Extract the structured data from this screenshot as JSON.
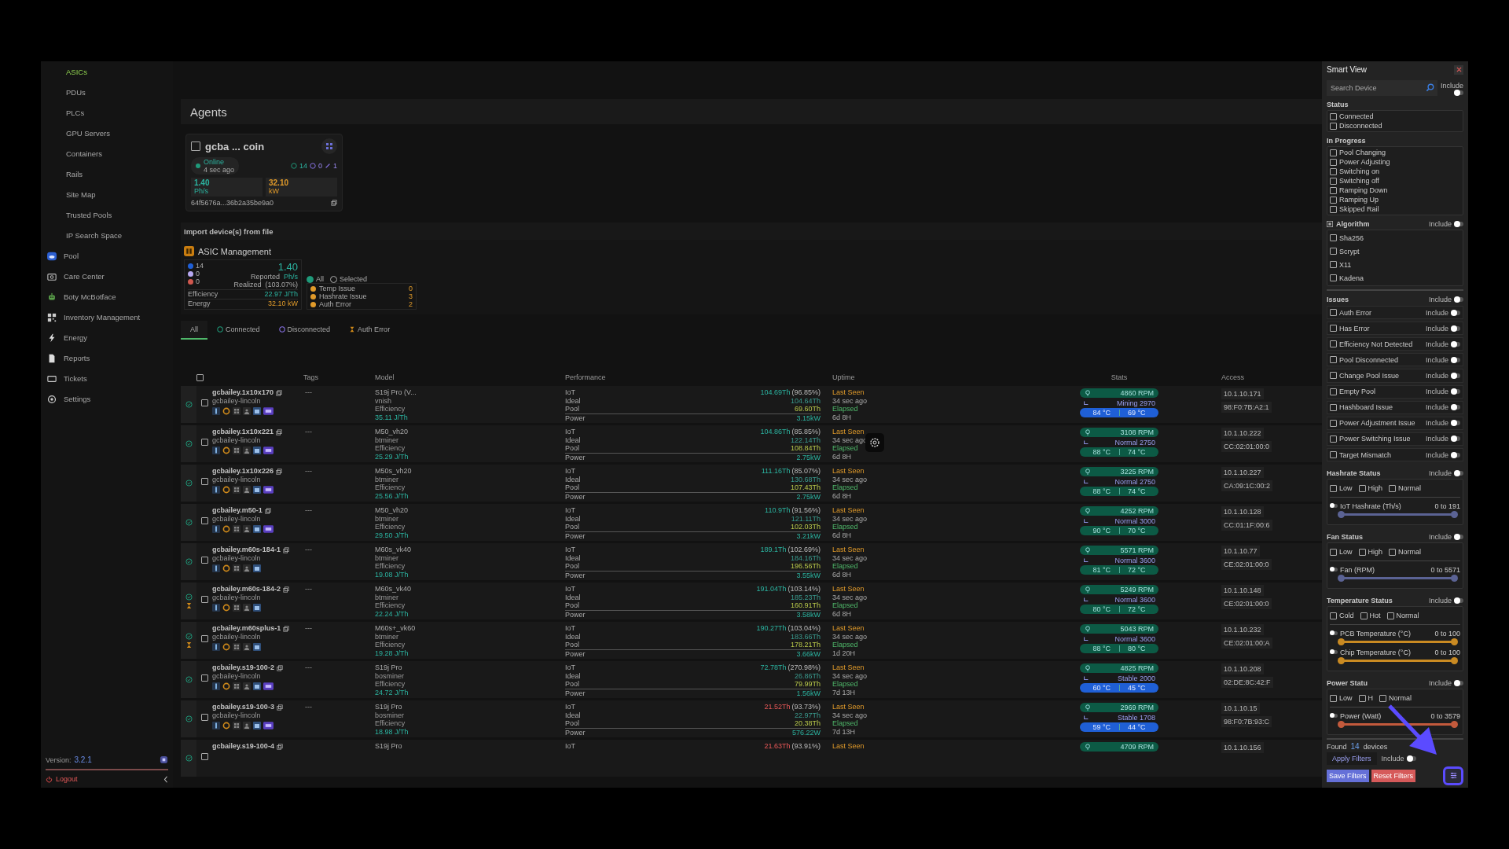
{
  "sidebar": {
    "sub_items": [
      {
        "label": "ASICs",
        "selected": true
      },
      {
        "label": "PDUs",
        "selected": false
      },
      {
        "label": "PLCs",
        "selected": false
      },
      {
        "label": "GPU Servers",
        "selected": false
      },
      {
        "label": "Containers",
        "selected": false
      },
      {
        "label": "Rails",
        "selected": false
      },
      {
        "label": "Site Map",
        "selected": false
      },
      {
        "label": "Trusted Pools",
        "selected": false
      },
      {
        "label": "IP Search Space",
        "selected": false
      }
    ],
    "items": [
      {
        "label": "Pool"
      },
      {
        "label": "Care Center"
      },
      {
        "label": "Boty McBotface"
      },
      {
        "label": "Inventory Management"
      },
      {
        "label": "Energy"
      },
      {
        "label": "Reports"
      },
      {
        "label": "Tickets"
      },
      {
        "label": "Settings"
      }
    ],
    "version_label": "Version:",
    "version": "3.2.1",
    "logout": "Logout"
  },
  "page_title": "Agents",
  "agent": {
    "name": "gcba ... coin",
    "checked": false,
    "status": "Online",
    "seen": "4 sec ago",
    "counts": [
      "14",
      "0",
      "1"
    ],
    "hashrate": "1.40",
    "hashrate_unit": "Ph/s",
    "power": "32.10",
    "power_unit": "kW",
    "id": "64f5676a...36b2a35be9a0"
  },
  "import_label": "Import device(s) from file",
  "management": {
    "title": "ASIC Management",
    "legend": [
      {
        "count": "14",
        "color": "#1f5fd6"
      },
      {
        "count": "0",
        "color": "#b7a8f0"
      },
      {
        "count": "0",
        "color": "#d0584f"
      }
    ],
    "reported": "1.40",
    "reported_label": "Reported",
    "reported_unit": "Ph/s",
    "realized_label": "Realized",
    "realized": "(103.07%)",
    "metrics": [
      {
        "label": "Efficiency",
        "value": "22.97 J/Th"
      },
      {
        "label": "Energy",
        "value": "32.10 kW"
      }
    ],
    "scope": [
      {
        "label": "All",
        "selected": true
      },
      {
        "label": "Selected",
        "selected": false
      }
    ],
    "issues": [
      {
        "label": "Temp Issue",
        "count": "0"
      },
      {
        "label": "Hashrate Issue",
        "count": "3"
      },
      {
        "label": "Auth Error",
        "count": "2"
      }
    ]
  },
  "tabs": [
    {
      "label": "All",
      "selected": true
    },
    {
      "label": "Connected",
      "selected": false
    },
    {
      "label": "Disconnected",
      "selected": false
    },
    {
      "label": "Auth Error",
      "selected": false
    }
  ],
  "table": {
    "select_all_checked": false,
    "columns": [
      "Tags",
      "Model",
      "Performance",
      "Uptime",
      "Stats",
      "Access"
    ],
    "rows": [
      {
        "name": "gcbailey.1x10x170",
        "checked": false,
        "owner": "gcbailey-lincoln",
        "pending": false,
        "badge": true,
        "tags": "---",
        "model": "S19j Pro (V...",
        "firmware": "vnish",
        "eff_label": "Efficiency",
        "efficiency": "35.11 J/Th",
        "low": false,
        "perf": [
          {
            "label": "IoT",
            "value": "104.69Th",
            "extra": "(96.85%)"
          },
          {
            "label": "Ideal",
            "value": "104.64Th"
          },
          {
            "label": "Pool",
            "value": "69.60Th"
          },
          {
            "label": "Power",
            "value": "3.15kW"
          }
        ],
        "last_label": "Last Seen",
        "last": "34 sec ago",
        "elapsed_label": "Elapsed",
        "elapsed": "6d 8H",
        "rpm": "4860 RPM",
        "fan": "Mining 2970",
        "t1": "84 °C",
        "t2": "69 °C",
        "cool": true,
        "ip": "10.1.10.171",
        "mac": "98:F0:7B:A2:1"
      },
      {
        "name": "gcbailey.1x10x221",
        "checked": false,
        "owner": "gcbailey-lincoln",
        "pending": false,
        "badge": true,
        "tags": "---",
        "model": "M50_vh20",
        "firmware": "btminer",
        "eff_label": "Efficiency",
        "efficiency": "25.29 J/Th",
        "low": false,
        "perf": [
          {
            "label": "IoT",
            "value": "104.86Th",
            "extra": "(85.85%)"
          },
          {
            "label": "Ideal",
            "value": "122.14Th"
          },
          {
            "label": "Pool",
            "value": "108.84Th"
          },
          {
            "label": "Power",
            "value": "2.75kW"
          }
        ],
        "last_label": "Last Seen",
        "last": "34 sec ago",
        "elapsed_label": "Elapsed",
        "elapsed": "6d 8H",
        "rpm": "3108 RPM",
        "fan": "Normal 2750",
        "t1": "88 °C",
        "t2": "74 °C",
        "cool": false,
        "ip": "10.1.10.222",
        "mac": "CC:02:01:00:0"
      },
      {
        "name": "gcbailey.1x10x226",
        "checked": false,
        "owner": "gcbailey-lincoln",
        "pending": false,
        "badge": true,
        "tags": "---",
        "model": "M50s_vh20",
        "firmware": "btminer",
        "eff_label": "Efficiency",
        "efficiency": "25.56 J/Th",
        "low": false,
        "perf": [
          {
            "label": "IoT",
            "value": "111.16Th",
            "extra": "(85.07%)"
          },
          {
            "label": "Ideal",
            "value": "130.68Th"
          },
          {
            "label": "Pool",
            "value": "107.43Th"
          },
          {
            "label": "Power",
            "value": "2.75kW"
          }
        ],
        "last_label": "Last Seen",
        "last": "34 sec ago",
        "elapsed_label": "Elapsed",
        "elapsed": "6d 8H",
        "rpm": "3225 RPM",
        "fan": "Normal 2750",
        "t1": "88 °C",
        "t2": "74 °C",
        "cool": false,
        "ip": "10.1.10.227",
        "mac": "CA:09:1C:00:2"
      },
      {
        "name": "gcbailey.m50-1",
        "checked": false,
        "owner": "gcbailey-lincoln",
        "pending": false,
        "badge": true,
        "tags": "---",
        "model": "M50_vh20",
        "firmware": "btminer",
        "eff_label": "Efficiency",
        "efficiency": "29.50 J/Th",
        "low": false,
        "perf": [
          {
            "label": "IoT",
            "value": "110.9Th",
            "extra": "(91.56%)"
          },
          {
            "label": "Ideal",
            "value": "121.11Th"
          },
          {
            "label": "Pool",
            "value": "102.03Th"
          },
          {
            "label": "Power",
            "value": "3.21kW"
          }
        ],
        "last_label": "Last Seen",
        "last": "34 sec ago",
        "elapsed_label": "Elapsed",
        "elapsed": "6d 8H",
        "rpm": "4252 RPM",
        "fan": "Normal 3000",
        "t1": "90 °C",
        "t2": "70 °C",
        "cool": false,
        "ip": "10.1.10.128",
        "mac": "CC:01:1F:00:6"
      },
      {
        "name": "gcbailey.m60s-184-1",
        "checked": false,
        "owner": "gcbailey-lincoln",
        "pending": false,
        "badge": false,
        "tags": "---",
        "model": "M60s_vk40",
        "firmware": "btminer",
        "eff_label": "Efficiency",
        "efficiency": "19.08 J/Th",
        "low": false,
        "perf": [
          {
            "label": "IoT",
            "value": "189.1Th",
            "extra": "(102.69%)"
          },
          {
            "label": "Ideal",
            "value": "184.16Th"
          },
          {
            "label": "Pool",
            "value": "196.56Th"
          },
          {
            "label": "Power",
            "value": "3.55kW"
          }
        ],
        "last_label": "Last Seen",
        "last": "34 sec ago",
        "elapsed_label": "Elapsed",
        "elapsed": "6d 8H",
        "rpm": "5571 RPM",
        "fan": "Normal 3600",
        "t1": "81 °C",
        "t2": "72 °C",
        "cool": false,
        "ip": "10.1.10.77",
        "mac": "CE:02:01:00:0"
      },
      {
        "name": "gcbailey.m60s-184-2",
        "checked": false,
        "owner": "gcbailey-lincoln",
        "pending": true,
        "badge": false,
        "tags": "---",
        "model": "M60s_vk40",
        "firmware": "btminer",
        "eff_label": "Efficiency",
        "efficiency": "22.24 J/Th",
        "low": false,
        "perf": [
          {
            "label": "IoT",
            "value": "191.04Th",
            "extra": "(103.14%)"
          },
          {
            "label": "Ideal",
            "value": "185.23Th"
          },
          {
            "label": "Pool",
            "value": "160.91Th"
          },
          {
            "label": "Power",
            "value": "3.58kW"
          }
        ],
        "last_label": "Last Seen",
        "last": "34 sec ago",
        "elapsed_label": "Elapsed",
        "elapsed": "6d 8H",
        "rpm": "5249 RPM",
        "fan": "Normal 3600",
        "t1": "80 °C",
        "t2": "72 °C",
        "cool": false,
        "ip": "10.1.10.148",
        "mac": "CE:02:01:00:0"
      },
      {
        "name": "gcbailey.m60splus-1",
        "checked": false,
        "owner": "gcbailey-lincoln",
        "pending": true,
        "badge": false,
        "tags": "---",
        "model": "M60s+_vk60",
        "firmware": "btminer",
        "eff_label": "Efficiency",
        "efficiency": "19.28 J/Th",
        "low": false,
        "perf": [
          {
            "label": "IoT",
            "value": "190.27Th",
            "extra": "(103.04%)"
          },
          {
            "label": "Ideal",
            "value": "183.66Th"
          },
          {
            "label": "Pool",
            "value": "178.21Th"
          },
          {
            "label": "Power",
            "value": "3.66kW"
          }
        ],
        "last_label": "Last Seen",
        "last": "34 sec ago",
        "elapsed_label": "Elapsed",
        "elapsed": "1d 20H",
        "rpm": "5043 RPM",
        "fan": "Normal 3600",
        "t1": "88 °C",
        "t2": "80 °C",
        "cool": false,
        "ip": "10.1.10.232",
        "mac": "CE:02:01:00:A"
      },
      {
        "name": "gcbailey.s19-100-2",
        "checked": false,
        "owner": "gcbailey-lincoln",
        "pending": false,
        "badge": true,
        "tags": "---",
        "model": "S19j Pro",
        "firmware": "bosminer",
        "eff_label": "Efficiency",
        "efficiency": "24.72 J/Th",
        "low": false,
        "perf": [
          {
            "label": "IoT",
            "value": "72.78Th",
            "extra": "(270.98%)"
          },
          {
            "label": "Ideal",
            "value": "26.86Th"
          },
          {
            "label": "Pool",
            "value": "79.99Th"
          },
          {
            "label": "Power",
            "value": "1.56kW"
          }
        ],
        "last_label": "Last Seen",
        "last": "34 sec ago",
        "elapsed_label": "Elapsed",
        "elapsed": "7d 13H",
        "rpm": "4825 RPM",
        "fan": "Stable 2000",
        "t1": "60 °C",
        "t2": "45 °C",
        "cool": true,
        "ip": "10.1.10.208",
        "mac": "02:DE:8C:42:F"
      },
      {
        "name": "gcbailey.s19-100-3",
        "checked": false,
        "owner": "gcbailey-lincoln",
        "pending": false,
        "badge": true,
        "tags": "---",
        "model": "S19j Pro",
        "firmware": "bosminer",
        "eff_label": "Efficiency",
        "efficiency": "18.98 J/Th",
        "low": true,
        "perf": [
          {
            "label": "IoT",
            "value": "21.52Th",
            "extra": "(93.73%)"
          },
          {
            "label": "Ideal",
            "value": "22.97Th"
          },
          {
            "label": "Pool",
            "value": "20.38Th"
          },
          {
            "label": "Power",
            "value": "576.22W"
          }
        ],
        "last_label": "Last Seen",
        "last": "34 sec ago",
        "elapsed_label": "Elapsed",
        "elapsed": "7d 13H",
        "rpm": "2969 RPM",
        "fan": "Stable 1708",
        "t1": "59 °C",
        "t2": "44 °C",
        "cool": true,
        "ip": "10.1.10.15",
        "mac": "98:F0:7B:93:C"
      },
      {
        "name": "gcbailey.s19-100-4",
        "checked": false,
        "model": "S19j Pro",
        "low": true,
        "perf": [
          {
            "label": "IoT",
            "value": "21.63Th",
            "extra": "(93.91%)"
          }
        ],
        "last_label": "Last Seen",
        "rpm": "4709 RPM",
        "ip": "10.1.10.156"
      }
    ]
  },
  "smart_view": {
    "title": "Smart View",
    "search_placeholder": "Search Device",
    "include_label": "Include",
    "include_on": false,
    "status": {
      "title": "Status",
      "options": [
        {
          "label": "Connected",
          "checked": false
        },
        {
          "label": "Disconnected",
          "checked": false
        }
      ]
    },
    "in_progress": {
      "title": "In Progress",
      "options": [
        {
          "label": "Pool Changing",
          "checked": false
        },
        {
          "label": "Power Adjusting",
          "checked": false
        },
        {
          "label": "Switching on",
          "checked": false
        },
        {
          "label": "Switching off",
          "checked": false
        },
        {
          "label": "Ramping Down",
          "checked": false
        },
        {
          "label": "Ramping Up",
          "checked": false
        },
        {
          "label": "Skipped Rail",
          "checked": false
        }
      ]
    },
    "algorithm": {
      "title": "Algorithm",
      "include_label": "Include",
      "include_on": false,
      "options": [
        {
          "label": "Sha256",
          "checked": false
        },
        {
          "label": "Scrypt",
          "checked": false
        },
        {
          "label": "X11",
          "checked": false
        },
        {
          "label": "Kadena",
          "checked": false
        }
      ]
    },
    "issues": {
      "title": "Issues",
      "include_label": "Include",
      "include_on": false,
      "options": [
        {
          "label": "Auth Error",
          "checked": false,
          "include_label": "Include",
          "include_on": false
        },
        {
          "label": "Has Error",
          "checked": false,
          "include_label": "Include",
          "include_on": false
        },
        {
          "label": "Efficiency Not Detected",
          "checked": false,
          "include_label": "Include",
          "include_on": false
        },
        {
          "label": "Pool Disconnected",
          "checked": false,
          "include_label": "Include",
          "include_on": false
        },
        {
          "label": "Change Pool Issue",
          "checked": false,
          "include_label": "Include",
          "include_on": false
        },
        {
          "label": "Empty Pool",
          "checked": false,
          "include_label": "Include",
          "include_on": false
        },
        {
          "label": "Hashboard Issue",
          "checked": false,
          "include_label": "Include",
          "include_on": false
        },
        {
          "label": "Power Adjustment Issue",
          "checked": false,
          "include_label": "Include",
          "include_on": false
        },
        {
          "label": "Power Switching Issue",
          "checked": false,
          "include_label": "Include",
          "include_on": false
        },
        {
          "label": "Target Mismatch",
          "checked": false,
          "include_label": "Include",
          "include_on": false
        }
      ]
    },
    "ranges": [
      {
        "title": "Hashrate Status",
        "include_label": "Include",
        "include_on": false,
        "options": [
          {
            "label": "Low",
            "checked": false
          },
          {
            "label": "High",
            "checked": false
          },
          {
            "label": "Normal",
            "checked": false
          }
        ],
        "sliders": [
          {
            "label": "IoT Hashrate (Th/s)",
            "on": false,
            "range": "0 to 191",
            "level": 1,
            "color": "#5b6394"
          }
        ]
      },
      {
        "title": "Fan Status",
        "include_label": "Include",
        "include_on": false,
        "options": [
          {
            "label": "Low",
            "checked": false
          },
          {
            "label": "High",
            "checked": false
          },
          {
            "label": "Normal",
            "checked": false
          }
        ],
        "sliders": [
          {
            "label": "Fan (RPM)",
            "on": false,
            "range": "0 to 5571",
            "level": 1,
            "color": "#5b6394"
          }
        ]
      },
      {
        "title": "Temperature Status",
        "include_label": "Include",
        "include_on": false,
        "options": [
          {
            "label": "Cold",
            "checked": false
          },
          {
            "label": "Hot",
            "checked": false
          },
          {
            "label": "Normal",
            "checked": false
          }
        ],
        "sliders": [
          {
            "label": "PCB Temperature (°C)",
            "on": false,
            "range": "0 to 100",
            "level": 1,
            "color": "#c98a22"
          },
          {
            "label": "Chip Temperature (°C)",
            "on": false,
            "range": "0 to 100",
            "level": 1,
            "color": "#c98a22"
          }
        ]
      },
      {
        "title": "Power Statu",
        "include_label": "Include",
        "include_on": false,
        "options": [
          {
            "label": "Low",
            "checked": false
          },
          {
            "label": "H",
            "checked": false
          },
          {
            "label": "Normal",
            "checked": false
          }
        ],
        "sliders": [
          {
            "label": "Power (Watt)",
            "on": false,
            "range": "0 to 3579",
            "level": 1,
            "color": "#c35a3c"
          }
        ]
      }
    ],
    "found_label": "Found",
    "found": "14",
    "found_unit": "devices",
    "apply": "Apply Filters",
    "apply_include_label": "Include",
    "apply_include_on": false,
    "save": "Save Filters",
    "reset": "Reset Filters"
  }
}
